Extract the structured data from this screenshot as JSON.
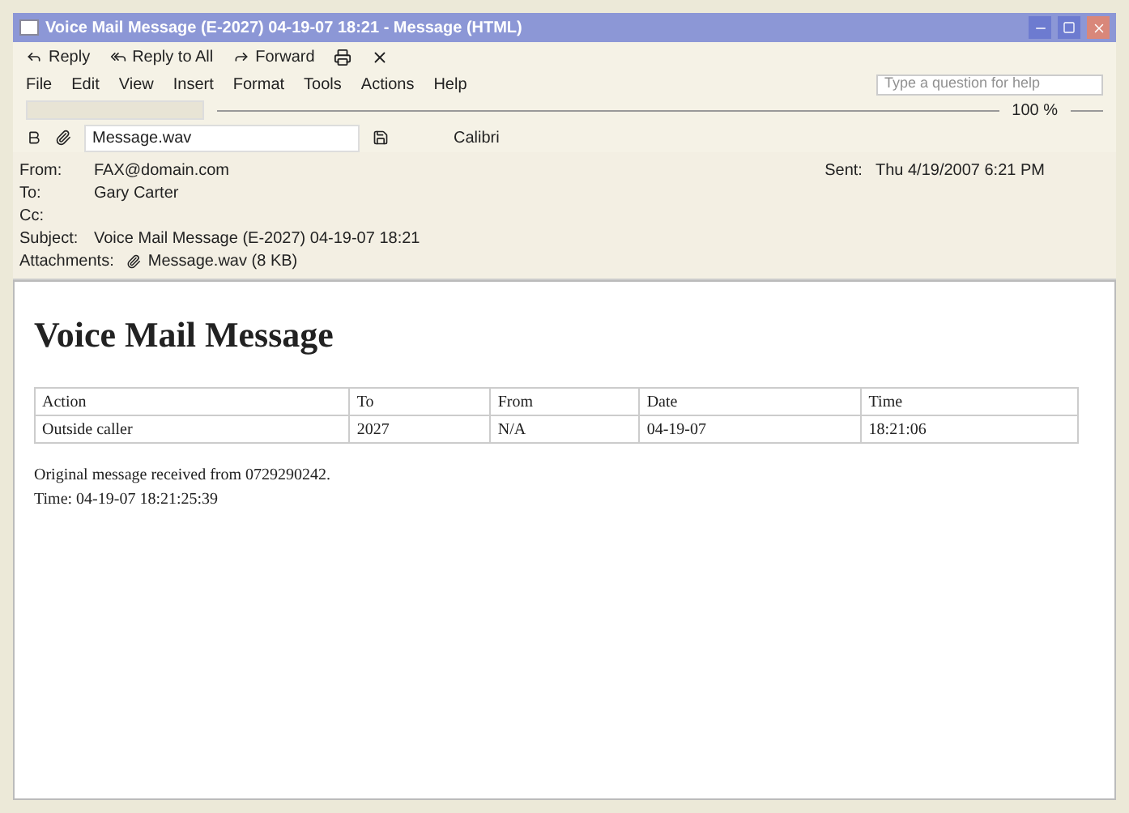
{
  "window": {
    "title": "Voice Mail Message (E-2027) 04-19-07 18:21 - Message (HTML)"
  },
  "toolbar": {
    "buttons": [
      {
        "label": "Reply"
      },
      {
        "label": "Reply to All"
      },
      {
        "label": "Forward"
      }
    ]
  },
  "menu": [
    "File",
    "Edit",
    "View",
    "Insert",
    "Format",
    "Tools",
    "Actions",
    "Help"
  ],
  "help_box": {
    "placeholder": "Type a question for help"
  },
  "zoom": {
    "label": "100 %"
  },
  "format_toolbar": {
    "attachment": "Message.wav",
    "font": "Calibri"
  },
  "header": {
    "fields": [
      {
        "label": "From:",
        "value": "FAX@domain.com"
      },
      {
        "label": "To:",
        "value": "Gary Carter"
      },
      {
        "label": "Cc:"
      },
      {
        "label": "Subject:",
        "value": "Voice Mail Message (E-2027) 04-19-07 18:21"
      }
    ],
    "attachments_label": "Attachments:",
    "attachment": "Message.wav (8 KB)",
    "sent_label": "Sent:",
    "sent": "Thu 4/19/2007 6:21 PM"
  },
  "body": {
    "heading": "Voice Mail Message",
    "table": {
      "columns": [
        "Action",
        "To",
        "From",
        "Date",
        "Time"
      ],
      "rows": [
        [
          "Outside caller",
          "2027",
          "N/A",
          "04-19-07",
          "18:21:06"
        ]
      ]
    },
    "lines": [
      "Original message received from 0729290242.",
      "Time: 04-19-07 18:21:25:39"
    ]
  }
}
